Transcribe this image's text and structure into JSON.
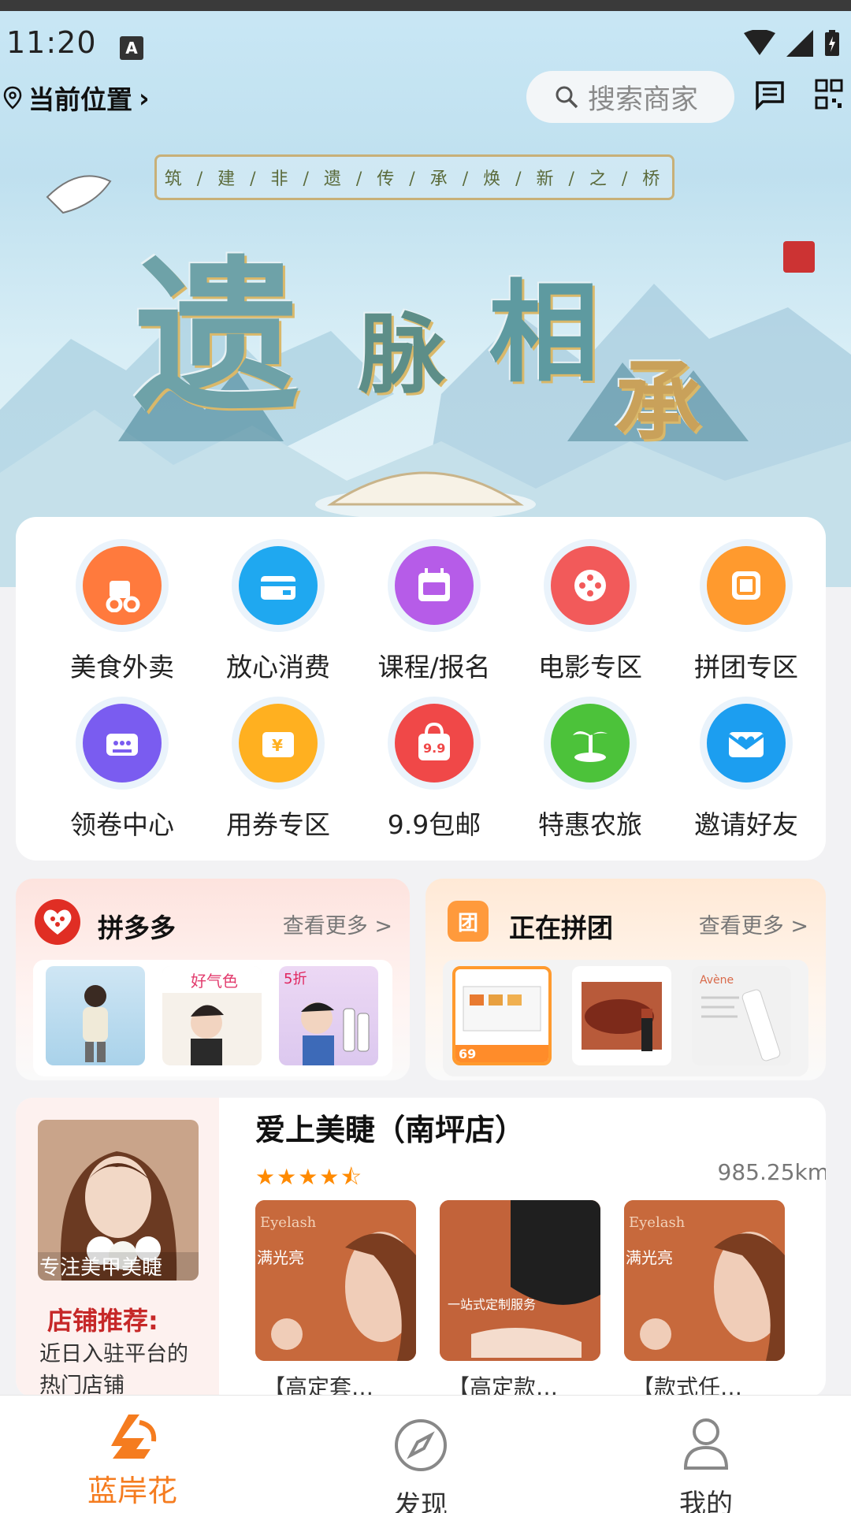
{
  "status_bar": {
    "time": "11:20",
    "sim_badge": "A"
  },
  "header": {
    "location_label": "当前位置",
    "location_arrow": "›",
    "search_placeholder": "搜索商家",
    "message_icon": "message-icon",
    "scan_icon": "qr-scan-icon"
  },
  "banner": {
    "slogan_chars": [
      "筑",
      "建",
      "非",
      "遗",
      "传",
      "承",
      "焕",
      "新",
      "之",
      "桥"
    ],
    "title_chars": [
      "遗",
      "脉",
      "相",
      "承"
    ]
  },
  "grid": {
    "items": [
      {
        "label": "美食外卖",
        "icon": "food-delivery-icon",
        "color": "#ff7a3d"
      },
      {
        "label": "放心消费",
        "icon": "card-icon",
        "color": "#1fa8f0"
      },
      {
        "label": "课程/报名",
        "icon": "calendar-signup-icon",
        "color": "#b65ce8"
      },
      {
        "label": "电影专区",
        "icon": "film-reel-icon",
        "color": "#f25a5a"
      },
      {
        "label": "拼团专区",
        "icon": "group-buy-icon",
        "color": "#ff9a2e"
      },
      {
        "label": "领卷中心",
        "icon": "coupon-basket-icon",
        "color": "#7a5cf0"
      },
      {
        "label": "用券专区",
        "icon": "yuan-coupon-icon",
        "color": "#ffb020"
      },
      {
        "label": "9.9包邮",
        "icon": "shopping-bag-icon",
        "color": "#f04848"
      },
      {
        "label": "特惠农旅",
        "icon": "palm-island-icon",
        "color": "#4cc23a"
      },
      {
        "label": "邀请好友",
        "icon": "invite-envelope-icon",
        "color": "#1c9ef0"
      }
    ]
  },
  "promos": [
    {
      "title": "拼多多",
      "more": "查看更多 >",
      "logo_icon": "pinduoduo-logo-icon"
    },
    {
      "title": "正在拼团",
      "more": "查看更多 >",
      "logo_icon": "group-logo-icon",
      "logo_text": "团"
    }
  ],
  "store": {
    "recommend_title": "店铺推荐:",
    "recommend_desc": "近日入驻平台的热门店铺",
    "photo_caption": "专注美甲美睫",
    "name": "爱上美睫（南坪店）",
    "stars": "★★★★⯪",
    "distance": "985.25km",
    "products": [
      {
        "caption": "【高定套…",
        "tag": "满光亮"
      },
      {
        "caption": "【高定款…",
        "tag": "一站式定制服务"
      },
      {
        "caption": "【款式任…",
        "tag": "满光亮"
      }
    ]
  },
  "bottom_nav": {
    "items": [
      {
        "label": "蓝岸花",
        "icon": "brand-logo-icon",
        "active": true
      },
      {
        "label": "发现",
        "icon": "compass-icon",
        "active": false
      },
      {
        "label": "我的",
        "icon": "profile-icon",
        "active": false
      }
    ],
    "active_color": "#f57c1f",
    "inactive_color": "#333333"
  }
}
